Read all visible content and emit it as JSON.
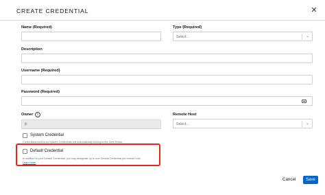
{
  "dialog": {
    "title": "CREATE CREDENTIAL",
    "close_icon": "close-icon"
  },
  "form": {
    "name": {
      "label": "Name (Required)",
      "value": ""
    },
    "type": {
      "label": "Type (Required)",
      "placeholder": "Select..."
    },
    "description": {
      "label": "Description",
      "value": ""
    },
    "username": {
      "label": "Username (Required)",
      "value": ""
    },
    "password": {
      "label": "Password (Required)",
      "value": "",
      "icon": "keyboard-icon"
    },
    "owner": {
      "label": "Owner",
      "value": "jli",
      "info_icon": "info-icon"
    },
    "remote_host": {
      "label": "Remote Host",
      "placeholder": "Select..."
    },
    "system_credential": {
      "label": "System Credential",
      "checked": false,
      "help": "Credentials marked as System Credentials will automatically belong to the Core Robot."
    },
    "default_credential": {
      "label": "Default Credential",
      "checked": false,
      "help": "In addition to your Default Credential, you may designate up to one Default Credential per remote host.",
      "link": "Learn more",
      "highlight_color": "#e8231d"
    }
  },
  "footer": {
    "cancel_label": "Cancel",
    "save_label": "Save",
    "save_color": "#0066cc"
  }
}
